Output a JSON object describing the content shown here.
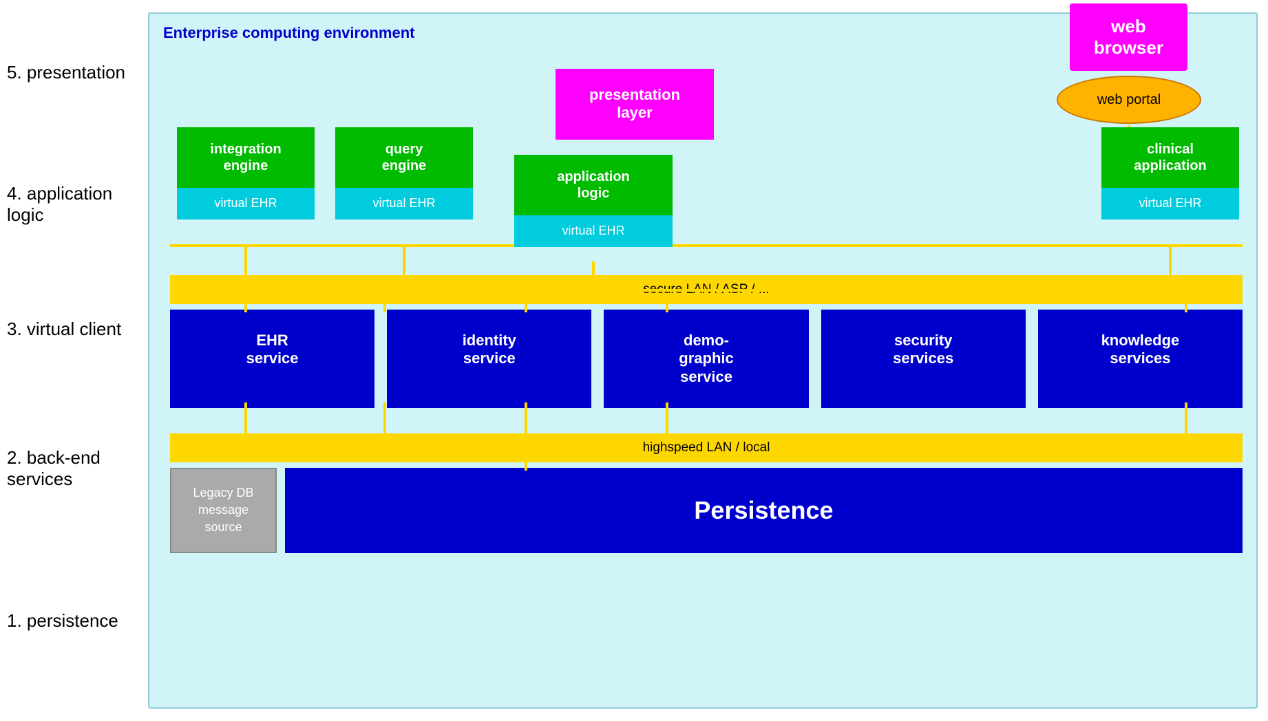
{
  "left_labels": {
    "label5": "5. presentation",
    "label4": "4. application\nlogic",
    "label3": "3. virtual client",
    "label2": "2. back-end\nservices",
    "label1": "1. persistence"
  },
  "diagram_title": "Enterprise computing environment",
  "web_browser": "web\nbrowser",
  "web_portal": "web portal",
  "presentation_layer": "presentation\nlayer",
  "vehr_blocks": [
    {
      "top": "integration\nengine",
      "bottom": "virtual EHR"
    },
    {
      "top": "query\nengine",
      "bottom": "virtual EHR"
    },
    {
      "top": "application\nlogic",
      "bottom": "virtual EHR"
    }
  ],
  "clinical_block": {
    "top": "clinical\napplication",
    "bottom": "virtual EHR"
  },
  "secure_lan": "secure LAN / ASP / ...",
  "services": [
    "EHR\nservice",
    "identity\nservice",
    "demo-\ngraphic\nservice",
    "security\nservices",
    "knowledge\nservices"
  ],
  "highspeed_lan": "highspeed LAN / local",
  "legacy_db": "Legacy DB\nmessage\nsource",
  "persistence": "Persistence",
  "colors": {
    "magenta": "#ff00ff",
    "green": "#00bb00",
    "cyan": "#00ccdd",
    "blue_dark": "#0000cc",
    "gold": "#FFD700",
    "light_blue_bg": "#d0f4f8",
    "gray": "#aaaaaa",
    "orange_ellipse": "#FFB300"
  }
}
